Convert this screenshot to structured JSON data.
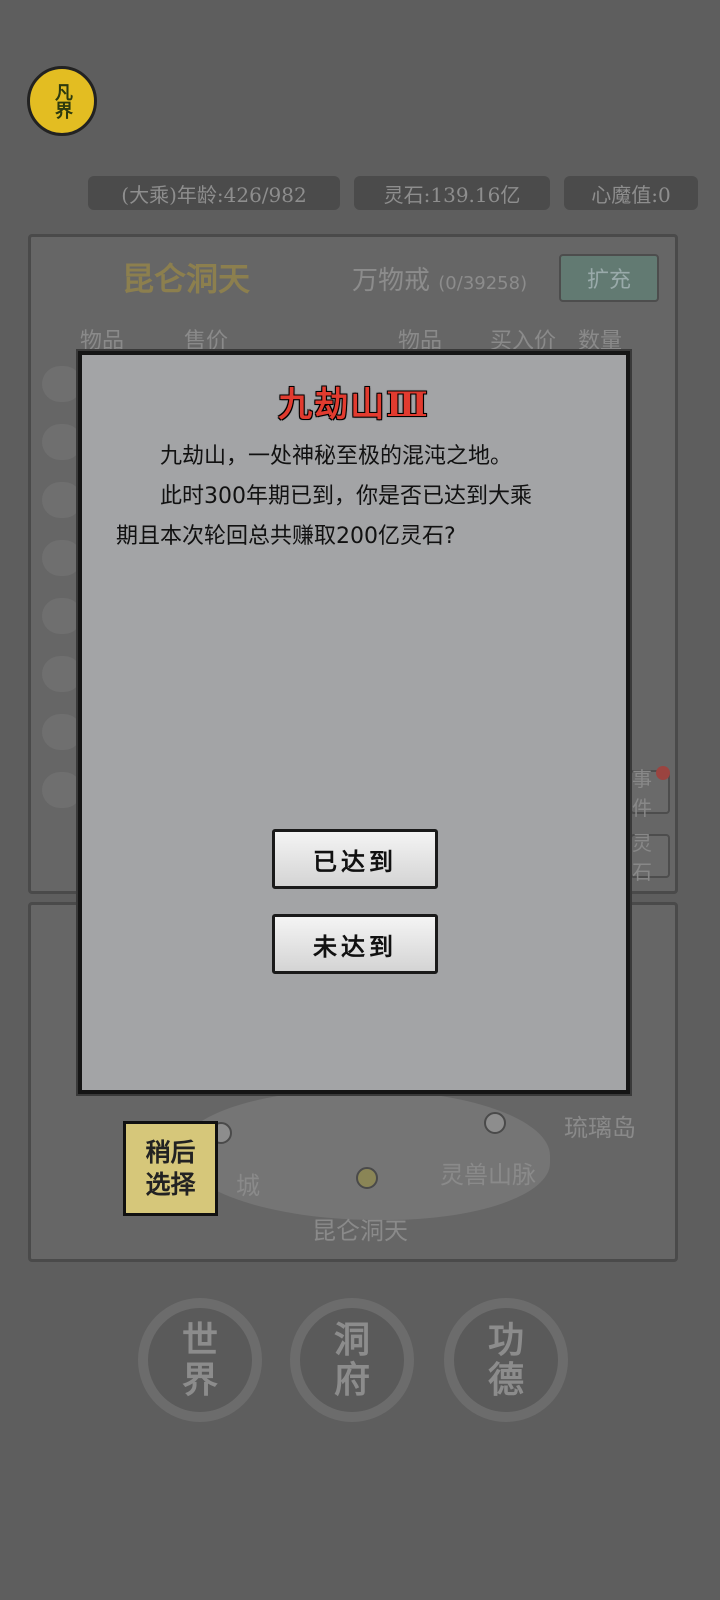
{
  "hud": {
    "logo_text": "凡界",
    "age": "(大乘)年龄:426/982",
    "spirit_stones": "灵石:139.16亿",
    "heart_demon": "心魔值:0"
  },
  "shop": {
    "title": "昆仑洞天",
    "ring_title": "万物戒",
    "ring_capacity": "(0/39258)",
    "expand_button": "扩充",
    "columns": {
      "item_left": "物品",
      "sell_price": "售价",
      "item_right": "物品",
      "buy_price": "买入价",
      "quantity": "数量"
    },
    "side_buttons": [
      "事件",
      "灵石"
    ]
  },
  "map": {
    "labels": {
      "liuli_island": "琉璃岛",
      "beast_mountains": "灵兽山脉",
      "kunlun": "昆仑洞天",
      "city": "城"
    },
    "later_button_line1": "稍后",
    "later_button_line2": "选择"
  },
  "nav": [
    {
      "line1": "世",
      "line2": "界"
    },
    {
      "line1": "洞",
      "line2": "府"
    },
    {
      "line1": "功",
      "line2": "德"
    }
  ],
  "dialog": {
    "title": "九劫山Ⅲ",
    "paragraph1": "九劫山，一处神秘至极的混沌之地。",
    "paragraph2a": "此时300年期已到，你是否已达到大乘",
    "paragraph2b": "期且本次轮回总共赚取200亿灵石?",
    "btn_reached": "已达到",
    "btn_not_reached": "未达到"
  },
  "colors": {
    "title_red": "#e23b2f",
    "dialog_bg": "#a3a4a6",
    "logo_gold": "#e3bd22",
    "later_btn": "#d6c77a"
  }
}
